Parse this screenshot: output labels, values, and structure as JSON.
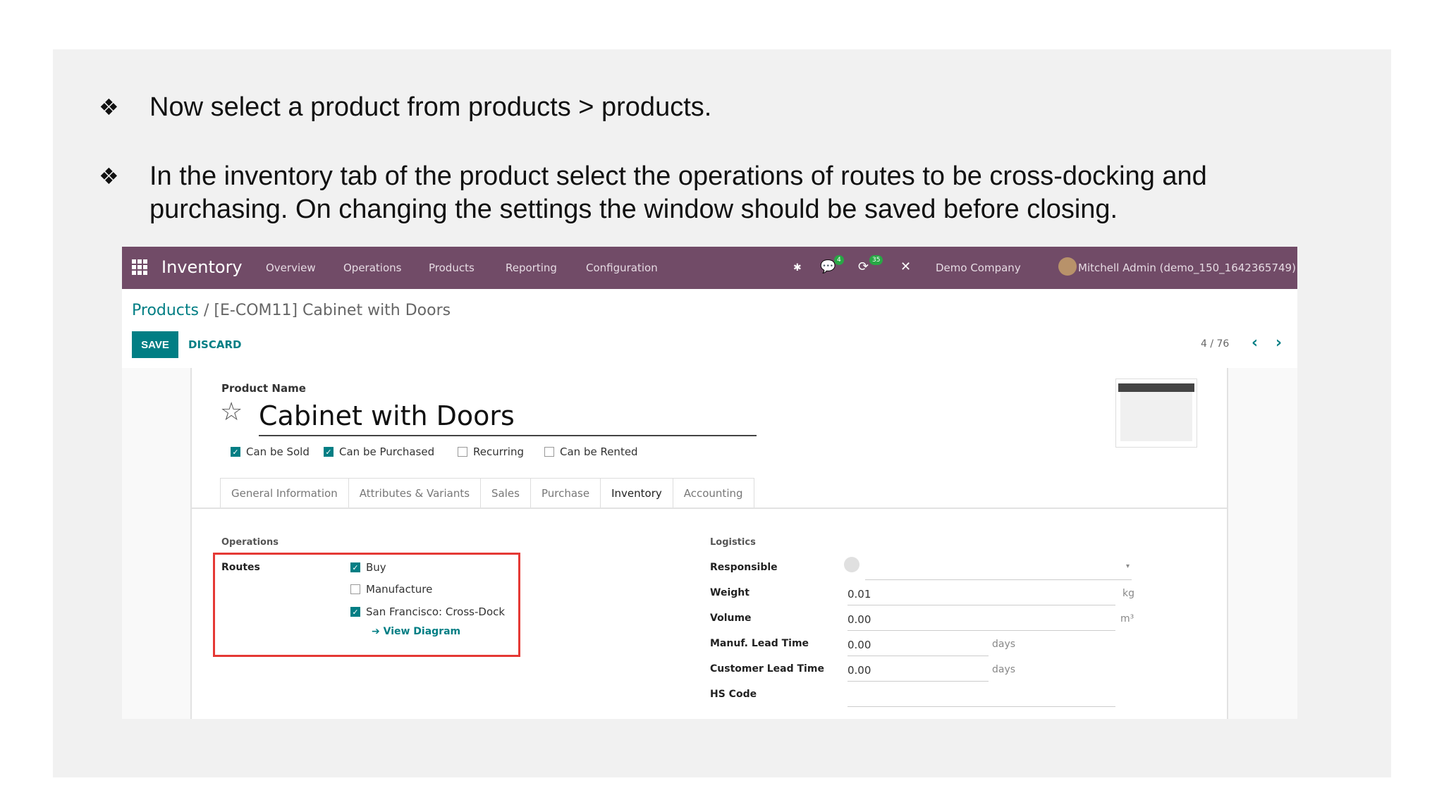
{
  "slide": {
    "bullets": [
      {
        "mark": "❖",
        "text": "Now select a product from products > products."
      },
      {
        "mark": "❖",
        "text": "In the inventory tab of the product select the operations of routes to be cross-docking and purchasing. On changing the settings the window should be saved before closing."
      }
    ]
  },
  "navbar": {
    "brand": "Inventory",
    "menu": [
      "Overview",
      "Operations",
      "Products",
      "Reporting",
      "Configuration"
    ],
    "badges": {
      "messages": "4",
      "activities": "35"
    },
    "company": "Demo Company",
    "user": "Mitchell Admin (demo_150_1642365749)"
  },
  "breadcrumb": {
    "root": "Products",
    "sep": " / ",
    "current": "[E-COM11] Cabinet with Doors"
  },
  "actions": {
    "save": "SAVE",
    "discard": "DISCARD"
  },
  "pager": {
    "value": "4 / 76"
  },
  "product": {
    "name_label": "Product Name",
    "name": "Cabinet with Doors",
    "options": [
      {
        "label": "Can be Sold",
        "checked": true
      },
      {
        "label": "Can be Purchased",
        "checked": true
      },
      {
        "label": "Recurring",
        "checked": false
      },
      {
        "label": "Can be Rented",
        "checked": false
      }
    ]
  },
  "tabs": [
    "General Information",
    "Attributes & Variants",
    "Sales",
    "Purchase",
    "Inventory",
    "Accounting"
  ],
  "active_tab": "Inventory",
  "operations": {
    "title": "Operations",
    "routes_label": "Routes",
    "routes": [
      {
        "label": "Buy",
        "checked": true
      },
      {
        "label": "Manufacture",
        "checked": false
      },
      {
        "label": "San Francisco: Cross-Dock",
        "checked": true
      }
    ],
    "view_diagram": "View Diagram"
  },
  "logistics": {
    "title": "Logistics",
    "responsible_label": "Responsible",
    "weight_label": "Weight",
    "weight": "0.01",
    "weight_unit": "kg",
    "volume_label": "Volume",
    "volume": "0.00",
    "volume_unit": "m³",
    "manuf_label": "Manuf. Lead Time",
    "manuf": "0.00",
    "manuf_unit": "days",
    "customer_label": "Customer Lead Time",
    "customer": "0.00",
    "customer_unit": "days",
    "hs_label": "HS Code"
  },
  "colors": {
    "brand": "#714b67",
    "accent": "#017e84",
    "highlight": "#e53935"
  }
}
